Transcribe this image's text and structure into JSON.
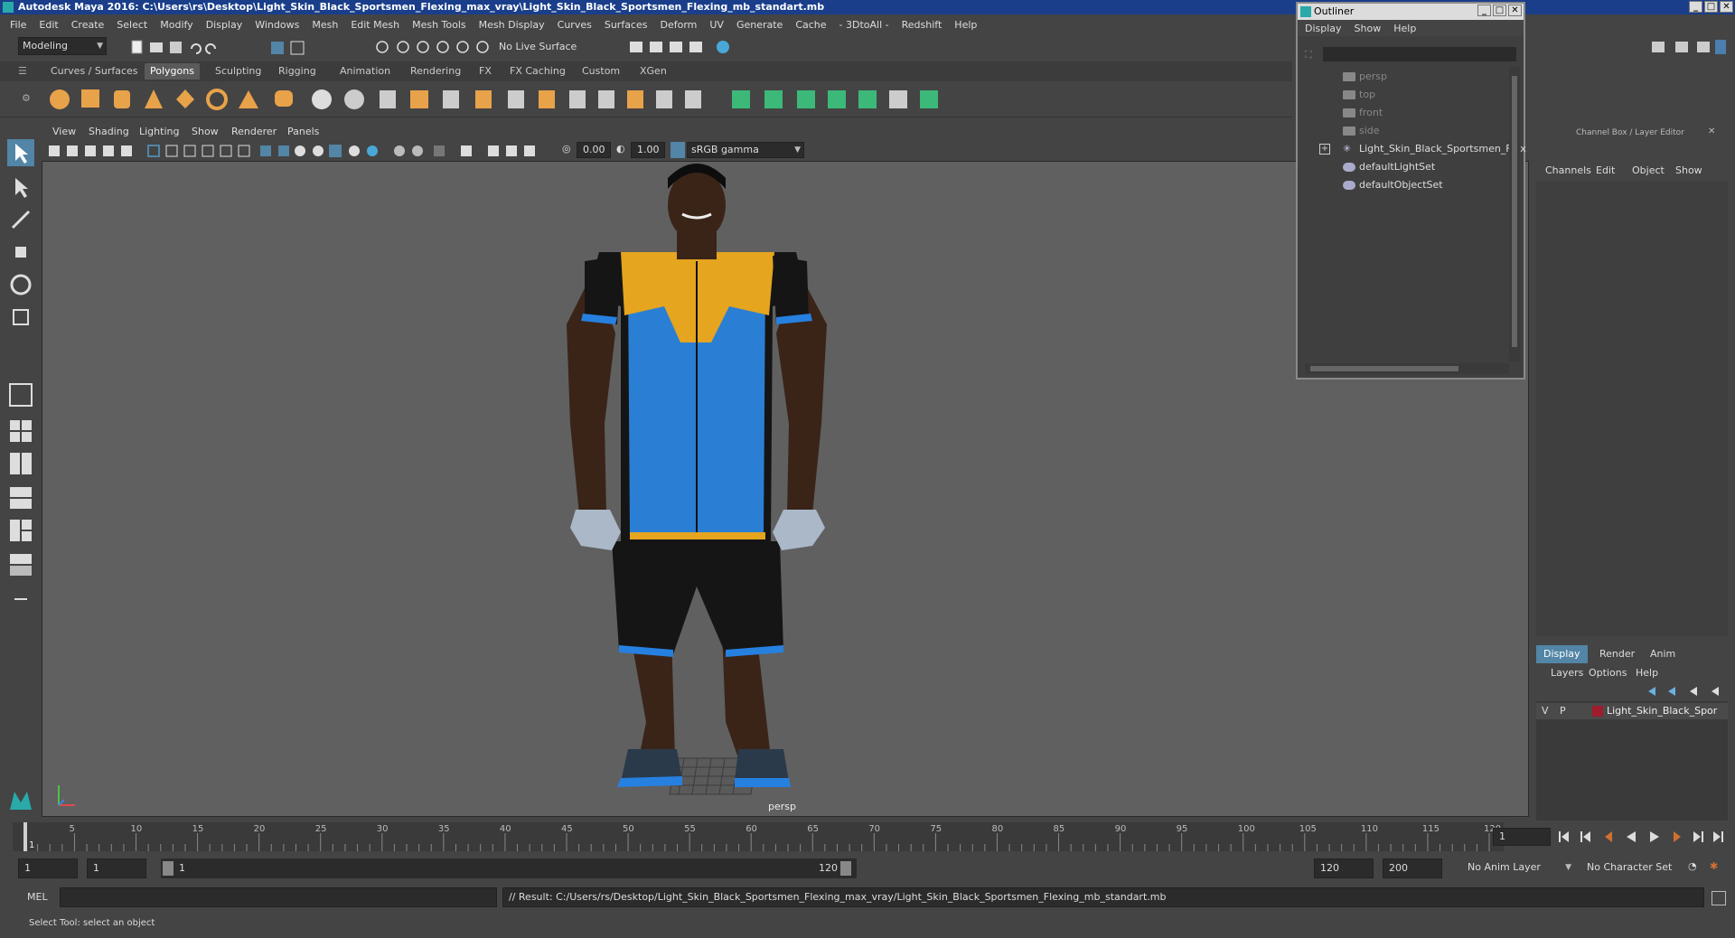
{
  "window": {
    "title": "Autodesk Maya 2016: C:\\Users\\rs\\Desktop\\Light_Skin_Black_Sportsmen_Flexing_max_vray\\Light_Skin_Black_Sportsmen_Flexing_mb_standart.mb"
  },
  "menubar": [
    "File",
    "Edit",
    "Create",
    "Select",
    "Modify",
    "Display",
    "Windows",
    "Mesh",
    "Edit Mesh",
    "Mesh Tools",
    "Mesh Display",
    "Curves",
    "Surfaces",
    "Deform",
    "UV",
    "Generate",
    "Cache",
    "- 3DtoAll -",
    "Redshift",
    "Help"
  ],
  "statusline": {
    "mode": "Modeling",
    "live_surface": "No Live Surface"
  },
  "shelf": {
    "tabs": [
      "Curves / Surfaces",
      "Polygons",
      "Sculpting",
      "Rigging",
      "Animation",
      "Rendering",
      "FX",
      "FX Caching",
      "Custom",
      "XGen"
    ],
    "active": "Polygons"
  },
  "viewport": {
    "menu": [
      "View",
      "Shading",
      "Lighting",
      "Show",
      "Renderer",
      "Panels"
    ],
    "exposure": "0.00",
    "gamma": "1.00",
    "colorspace": "sRGB gamma",
    "camera_label": "persp"
  },
  "outliner": {
    "title": "Outliner",
    "menu": [
      "Display",
      "Show",
      "Help"
    ],
    "items": [
      {
        "label": "persp",
        "dim": true
      },
      {
        "label": "top",
        "dim": true
      },
      {
        "label": "front",
        "dim": true
      },
      {
        "label": "side",
        "dim": true
      },
      {
        "label": "Light_Skin_Black_Sportsmen_Flex",
        "dim": false
      },
      {
        "label": "defaultLightSet",
        "dim": false
      },
      {
        "label": "defaultObjectSet",
        "dim": false
      }
    ]
  },
  "channelbox": {
    "title": "Channel Box / Layer Editor",
    "menu": [
      "Channels",
      "Edit",
      "Object",
      "Show"
    ],
    "layer_tabs": [
      "Display",
      "Render",
      "Anim"
    ],
    "layer_menu": [
      "Layers",
      "Options",
      "Help"
    ],
    "layer": {
      "v": "V",
      "p": "P",
      "name": "Light_Skin_Black_Spor"
    }
  },
  "timeline": {
    "ticks": [
      "5",
      "10",
      "15",
      "20",
      "25",
      "30",
      "35",
      "40",
      "45",
      "50",
      "55",
      "60",
      "65",
      "70",
      "75",
      "80",
      "85",
      "90",
      "95",
      "100",
      "105",
      "110",
      "115",
      "120"
    ],
    "start_tick": "1",
    "current_frame": "1"
  },
  "range": {
    "start": "1",
    "playback_start": "1",
    "slider_start": "1",
    "slider_end": "120",
    "playback_end": "120",
    "end": "200",
    "anim_layer": "No Anim Layer",
    "char_set": "No Character Set"
  },
  "cmdline": {
    "lang": "MEL",
    "result": "// Result: C:/Users/rs/Desktop/Light_Skin_Black_Sportsmen_Flexing_max_vray/Light_Skin_Black_Sportsmen_Flexing_mb_standart.mb"
  },
  "helpline": {
    "text": "Select Tool: select an object"
  },
  "colors": {
    "accent": "#5285a6",
    "title_bar": "#1a3e8a"
  }
}
